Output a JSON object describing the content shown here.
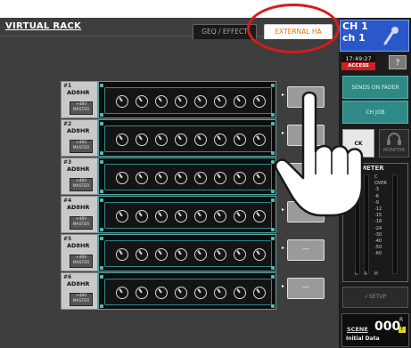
{
  "screen": {
    "title": "VIRTUAL RACK",
    "tabs": [
      {
        "label": "GEQ / EFFECT"
      },
      {
        "label": "EXTERNAL HA"
      }
    ]
  },
  "rack": {
    "slots": [
      {
        "num": "#1",
        "model": "AD8HR",
        "master": "+48V MASTER",
        "button": ""
      },
      {
        "num": "#2",
        "model": "AD8HR",
        "master": "+48V MASTER",
        "button": ""
      },
      {
        "num": "#3",
        "model": "AD8HR",
        "master": "+48V MASTER",
        "button": ""
      },
      {
        "num": "#4",
        "model": "AD8HR",
        "master": "+48V MASTER",
        "button": "—"
      },
      {
        "num": "#5",
        "model": "AD8HR",
        "master": "+48V MASTER",
        "button": "—"
      },
      {
        "num": "#6",
        "model": "AD8HR",
        "master": "+48V MASTER",
        "button": "—"
      }
    ]
  },
  "right_panel": {
    "ch_line1": "CH 1",
    "ch_line2": "ch 1",
    "time": "17:49:27",
    "access": "ACCESS",
    "help": "?",
    "sends_on_fader": "SENDS ON FADER",
    "ch_job": "CH JOB",
    "cue_lock": "CK",
    "monitor": "MONITOR",
    "meter_title": "METER",
    "meter_scale": [
      "C",
      "OVER",
      "-3",
      "-6",
      "-9",
      "-12",
      "-15",
      "-18",
      "-24",
      "-30",
      "-40",
      "-50",
      "-60"
    ],
    "meter_lam": "L  R  M",
    "setup": "SETUP",
    "scene_label": "SCENE",
    "scene_number": "000",
    "scene_r": "R",
    "scene_e": "E",
    "scene_name": "Initial Data"
  },
  "colors": {
    "accent_teal": "#2f8a86",
    "tab_active_text": "#e8740c",
    "highlight_circle": "#d81b1b",
    "ch_blue": "#2a58c9"
  }
}
